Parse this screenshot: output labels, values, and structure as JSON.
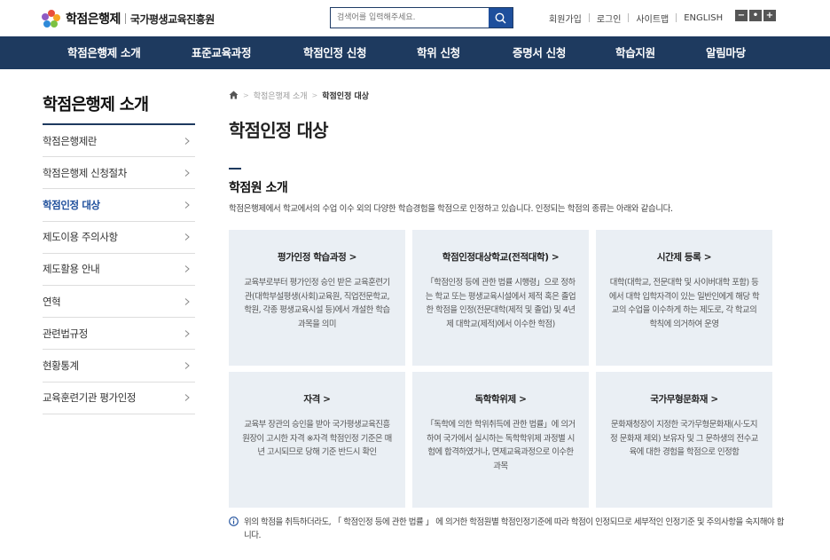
{
  "header": {
    "logo_title": "학점은행제",
    "logo_org": "국가평생교육진흥원",
    "search_placeholder": "검색어를 입력해주세요.",
    "util_links": [
      "회원가입",
      "로그인",
      "사이트맵",
      "ENGLISH"
    ],
    "zoom_buttons": [
      "−",
      "•",
      "+"
    ]
  },
  "gnb": [
    "학점은행제 소개",
    "표준교육과정",
    "학점인정 신청",
    "학위 신청",
    "증명서 신청",
    "학습지원",
    "알림마당"
  ],
  "lnb": {
    "title": "학점은행제 소개",
    "items": [
      {
        "label": "학점은행제란",
        "active": false
      },
      {
        "label": "학점은행제 신청절차",
        "active": false
      },
      {
        "label": "학점인정 대상",
        "active": true
      },
      {
        "label": "제도이용 주의사항",
        "active": false
      },
      {
        "label": "제도활용 안내",
        "active": false
      },
      {
        "label": "연혁",
        "active": false
      },
      {
        "label": "관련법규정",
        "active": false
      },
      {
        "label": "현황통계",
        "active": false
      },
      {
        "label": "교육훈련기관 평가인정",
        "active": false
      }
    ]
  },
  "breadcrumb": [
    "학점은행제 소개",
    "학점인정 대상"
  ],
  "page_title": "학점인정 대상",
  "section": {
    "title": "학점원 소개",
    "desc": "학점은행제에서 학교에서의 수업 이수 외의 다양한 학습경험을 학점으로 인정하고 있습니다. 인정되는 학점의 종류는 아래와 같습니다."
  },
  "cards": [
    {
      "title": "평가인정 학습과정 >",
      "desc": "교육부로부터 평가인정 승인 받은 교육훈련기관(대학부설평생(사회)교육원, 직업전문학교, 학원, 각종 평생교육시설 등)에서 개설한 학습과목을 의미"
    },
    {
      "title": "학점인정대상학교(전적대학) >",
      "desc": "「학점인정 등에 관한 법률 시행령」으로 정하는 학교 또는 평생교육시설에서 제적 혹은 졸업한 학점을 인정(전문대학(제적 및 졸업) 및 4년제 대학교(제적)에서 이수한 학점)"
    },
    {
      "title": "시간제 등록 >",
      "desc": "대학(대학교, 전문대학 및 사이버대학 포함) 등 에서 대학 입학자격이 있는 일반인에게 해당 학교의 수업을 이수하게 하는 제도로, 각 학교의 학칙에 의거하여 운영"
    },
    {
      "title": "자격 >",
      "desc": "교육부 장관의 승인을 받아 국가평생교육진흥원장이 고시한 자격 ※자격 학점인정 기준은 매년 고시되므로 당해 기준 반드시 확인"
    },
    {
      "title": "독학학위제 >",
      "desc": "「독학에 의한 학위취득에 관한 법률」에 의거하여 국가에서 실시하는 독학학위제 과정별 시험에 합격하였거나, 면제교육과정으로 이수한 과목"
    },
    {
      "title": "국가무형문화재 >",
      "desc": "문화재청장이 지정한 국가무형문화재(시·도지정 문화재 제외) 보유자 및 그 문하생의 전수교육에 대한 경험을 학점으로 인정함"
    }
  ],
  "notice": "위의 학점을 취득하더라도, 「 학점인정 등에 관한 법률 」 에 의거한 학점원별 학점인정기준에 따라 학점이 인정되므로 세부적인 인정기준 및 주의사항을 숙지해야 합니다.",
  "colors": {
    "navy": "#1e3a5f",
    "accent_blue": "#1e4f9c",
    "card_bg": "#eaeff4"
  }
}
